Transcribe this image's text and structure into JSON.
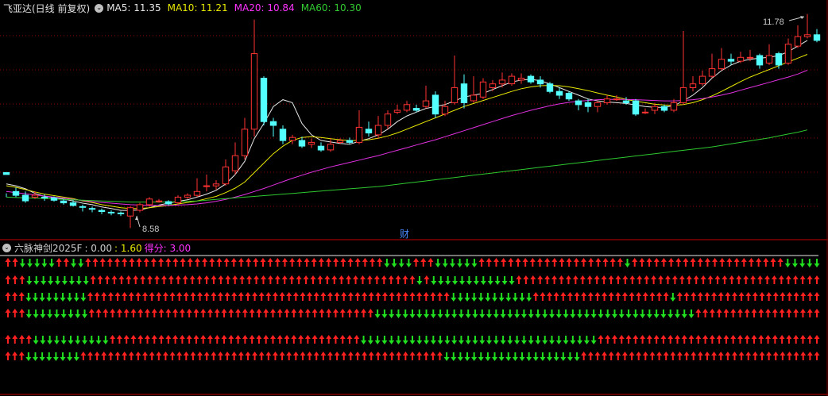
{
  "main_panel": {
    "title": "飞亚达(日线 前复权)",
    "ma_items": [
      {
        "label": "MA5: 11.35",
        "color": "#e8e8e8"
      },
      {
        "label": "MA10: 11.21",
        "color": "#e8e800"
      },
      {
        "label": "MA20: 10.84",
        "color": "#ff33ff"
      },
      {
        "label": "MA60: 10.30",
        "color": "#33cc33"
      }
    ],
    "high_label": "11.78",
    "low_label": "8.58",
    "finance_marker": "财"
  },
  "indicator_panel": {
    "title": "六脉神剑2025F",
    "values": [
      {
        "label": ": 0.00",
        "color": "#d0d0d0"
      },
      {
        "label": ": 1.60",
        "color": "#e8e800"
      },
      {
        "label": "得分: 3.00",
        "color": "#ff33ff"
      }
    ]
  },
  "colors": {
    "up": "#ff3333",
    "down": "#54ffff",
    "ma5": "#e8e8e8",
    "ma10": "#e8e800",
    "ma20": "#e030e0",
    "ma60": "#2ec82e",
    "arrow_up": "#ff2020",
    "arrow_down": "#20e020",
    "grid": "#8b0000",
    "separator": "#c00000"
  },
  "icons": {
    "settings": "circle-chevron-icon",
    "up_arrow": "red-up-arrow-icon",
    "down_arrow": "green-down-arrow-icon"
  },
  "chart_data": {
    "type": "candlestick",
    "y_unit": "price",
    "candles": [
      [
        10.05,
        10.0,
        9.4,
        9.5
      ],
      [
        9.55,
        9.45,
        9.65,
        9.4
      ],
      [
        9.45,
        9.3,
        9.55,
        9.25
      ],
      [
        9.4,
        9.45,
        9.55,
        9.35
      ],
      [
        9.4,
        9.38,
        9.48,
        9.3
      ],
      [
        9.38,
        9.32,
        9.42,
        9.28
      ],
      [
        9.3,
        9.25,
        9.35,
        9.2
      ],
      [
        9.25,
        9.18,
        9.32,
        9.15
      ],
      [
        9.15,
        9.13,
        9.2,
        9.02
      ],
      [
        9.1,
        9.08,
        9.15,
        9.0
      ],
      [
        9.05,
        9.02,
        9.1,
        8.95
      ],
      [
        9.0,
        8.98,
        9.05,
        8.92
      ],
      [
        8.98,
        8.96,
        9.02,
        8.9
      ],
      [
        8.9,
        9.12,
        9.15,
        8.58
      ],
      [
        9.05,
        9.2,
        9.25,
        9.0
      ],
      [
        9.2,
        9.35,
        9.4,
        9.15
      ],
      [
        9.3,
        9.3,
        9.35,
        9.25
      ],
      [
        9.28,
        9.22,
        9.32,
        9.18
      ],
      [
        9.25,
        9.4,
        9.45,
        9.2
      ],
      [
        9.4,
        9.45,
        9.5,
        9.35
      ],
      [
        9.45,
        9.55,
        9.9,
        9.4
      ],
      [
        9.7,
        9.7,
        10.0,
        9.55
      ],
      [
        9.7,
        9.75,
        9.85,
        9.6
      ],
      [
        9.75,
        10.2,
        10.4,
        9.7
      ],
      [
        10.1,
        10.5,
        10.85,
        10.0
      ],
      [
        10.5,
        11.2,
        11.5,
        10.4
      ],
      [
        11.2,
        13.2,
        14.1,
        11.0
      ],
      [
        12.55,
        11.4,
        12.6,
        11.3
      ],
      [
        11.4,
        11.3,
        11.5,
        11.0
      ],
      [
        11.2,
        10.9,
        11.3,
        10.8
      ],
      [
        10.9,
        10.98,
        11.05,
        10.8
      ],
      [
        10.9,
        10.75,
        11.0,
        10.7
      ],
      [
        10.8,
        10.85,
        10.95,
        10.7
      ],
      [
        10.75,
        10.65,
        10.85,
        10.6
      ],
      [
        10.65,
        10.8,
        10.95,
        10.6
      ],
      [
        10.85,
        10.9,
        10.95,
        10.8
      ],
      [
        10.9,
        10.85,
        10.98,
        10.8
      ],
      [
        10.85,
        11.25,
        11.7,
        10.8
      ],
      [
        11.2,
        11.1,
        11.4,
        11.0
      ],
      [
        11.05,
        11.3,
        11.55,
        10.95
      ],
      [
        11.3,
        11.6,
        11.7,
        11.2
      ],
      [
        11.65,
        11.7,
        11.85,
        11.6
      ],
      [
        11.7,
        11.85,
        11.95,
        11.65
      ],
      [
        11.75,
        11.7,
        11.85,
        11.65
      ],
      [
        11.8,
        11.95,
        12.35,
        11.75
      ],
      [
        12.1,
        11.6,
        12.2,
        11.5
      ],
      [
        11.6,
        11.8,
        11.95,
        11.55
      ],
      [
        11.9,
        12.3,
        13.15,
        11.85
      ],
      [
        12.4,
        11.9,
        12.65,
        11.75
      ],
      [
        11.95,
        12.1,
        12.6,
        11.9
      ],
      [
        12.05,
        12.45,
        12.55,
        12.0
      ],
      [
        12.3,
        12.4,
        12.5,
        12.2
      ],
      [
        12.4,
        12.5,
        12.7,
        12.3
      ],
      [
        12.4,
        12.6,
        12.68,
        12.35
      ],
      [
        12.5,
        12.55,
        12.68,
        12.4
      ],
      [
        12.6,
        12.45,
        12.65,
        12.4
      ],
      [
        12.5,
        12.4,
        12.6,
        12.3
      ],
      [
        12.4,
        12.2,
        12.45,
        12.15
      ],
      [
        12.2,
        12.1,
        12.3,
        12.0
      ],
      [
        12.15,
        12.0,
        12.2,
        11.95
      ],
      [
        11.95,
        11.85,
        12.0,
        11.7
      ],
      [
        11.9,
        11.8,
        12.0,
        11.65
      ],
      [
        11.8,
        11.9,
        11.95,
        11.65
      ],
      [
        11.9,
        12.0,
        12.1,
        11.85
      ],
      [
        12.0,
        12.0,
        12.1,
        11.95
      ],
      [
        11.95,
        11.9,
        12.05,
        11.85
      ],
      [
        11.95,
        11.6,
        12.0,
        11.55
      ],
      [
        11.65,
        11.65,
        11.75,
        11.6
      ],
      [
        11.7,
        11.8,
        11.9,
        11.6
      ],
      [
        11.8,
        11.7,
        11.85,
        11.65
      ],
      [
        11.7,
        11.9,
        12.0,
        11.65
      ],
      [
        11.9,
        12.3,
        13.8,
        11.85
      ],
      [
        12.3,
        12.4,
        12.6,
        12.2
      ],
      [
        12.4,
        12.6,
        12.75,
        12.35
      ],
      [
        12.6,
        12.8,
        13.2,
        12.55
      ],
      [
        12.8,
        13.05,
        13.35,
        12.75
      ],
      [
        13.05,
        13.0,
        13.2,
        12.9
      ],
      [
        13.0,
        13.1,
        13.25,
        12.95
      ],
      [
        13.1,
        13.1,
        13.3,
        13.0
      ],
      [
        13.15,
        12.9,
        13.2,
        12.8
      ],
      [
        12.95,
        13.15,
        13.45,
        12.9
      ],
      [
        13.2,
        12.9,
        13.25,
        12.8
      ],
      [
        12.95,
        13.45,
        13.6,
        12.9
      ],
      [
        13.4,
        13.65,
        13.95,
        13.35
      ],
      [
        13.65,
        13.7,
        14.25,
        13.6
      ],
      [
        13.7,
        13.55,
        13.85,
        13.5
      ]
    ],
    "ma_series": [
      {
        "name": "MA5",
        "values": [
          9.75,
          9.7,
          9.62,
          9.5,
          9.42,
          9.39,
          9.35,
          9.3,
          9.24,
          9.2,
          9.14,
          9.1,
          9.05,
          9.05,
          9.06,
          9.12,
          9.19,
          9.24,
          9.29,
          9.33,
          9.4,
          9.48,
          9.58,
          9.75,
          10.0,
          10.35,
          10.95,
          11.35,
          11.8,
          11.98,
          11.9,
          11.35,
          11.05,
          10.9,
          10.86,
          10.82,
          10.8,
          10.88,
          10.95,
          11.05,
          11.2,
          11.4,
          11.55,
          11.65,
          11.75,
          11.8,
          11.85,
          11.95,
          12.05,
          12.1,
          12.15,
          12.25,
          12.35,
          12.45,
          12.5,
          12.52,
          12.48,
          12.4,
          12.3,
          12.2,
          12.1,
          12.0,
          11.95,
          11.92,
          11.9,
          11.88,
          11.84,
          11.8,
          11.78,
          11.78,
          11.82,
          11.95,
          12.1,
          12.3,
          12.55,
          12.75,
          12.9,
          13.0,
          13.05,
          13.08,
          13.1,
          13.15,
          13.25,
          13.4,
          13.55
        ]
      },
      {
        "name": "MA10",
        "values": [
          9.7,
          9.66,
          9.6,
          9.54,
          9.48,
          9.44,
          9.4,
          9.36,
          9.3,
          9.26,
          9.2,
          9.16,
          9.12,
          9.1,
          9.1,
          9.12,
          9.15,
          9.18,
          9.22,
          9.26,
          9.3,
          9.36,
          9.42,
          9.52,
          9.64,
          9.8,
          10.05,
          10.3,
          10.55,
          10.75,
          10.9,
          10.98,
          11.0,
          10.98,
          10.95,
          10.92,
          10.9,
          10.9,
          10.92,
          10.96,
          11.02,
          11.1,
          11.2,
          11.3,
          11.4,
          11.5,
          11.6,
          11.7,
          11.8,
          11.88,
          11.96,
          12.04,
          12.12,
          12.2,
          12.27,
          12.32,
          12.35,
          12.36,
          12.35,
          12.32,
          12.27,
          12.22,
          12.16,
          12.1,
          12.05,
          11.99,
          11.94,
          11.9,
          11.86,
          11.84,
          11.83,
          11.85,
          11.9,
          11.98,
          12.08,
          12.2,
          12.33,
          12.46,
          12.58,
          12.68,
          12.78,
          12.88,
          12.98,
          13.08,
          13.18
        ]
      },
      {
        "name": "MA20",
        "values": [
          9.55,
          9.52,
          9.49,
          9.46,
          9.43,
          9.4,
          9.37,
          9.34,
          9.31,
          9.28,
          9.26,
          9.24,
          9.22,
          9.2,
          9.19,
          9.18,
          9.18,
          9.18,
          9.19,
          9.2,
          9.22,
          9.25,
          9.29,
          9.34,
          9.4,
          9.47,
          9.55,
          9.63,
          9.72,
          9.81,
          9.9,
          9.98,
          10.06,
          10.13,
          10.2,
          10.26,
          10.32,
          10.38,
          10.44,
          10.5,
          10.57,
          10.64,
          10.71,
          10.78,
          10.85,
          10.92,
          11.0,
          11.08,
          11.16,
          11.24,
          11.32,
          11.4,
          11.48,
          11.56,
          11.63,
          11.7,
          11.76,
          11.82,
          11.87,
          11.91,
          11.94,
          11.96,
          11.98,
          11.99,
          11.99,
          11.99,
          11.98,
          11.97,
          11.96,
          11.95,
          11.95,
          11.96,
          11.98,
          12.01,
          12.05,
          12.1,
          12.16,
          12.23,
          12.3,
          12.37,
          12.44,
          12.51,
          12.58,
          12.66,
          12.76
        ]
      },
      {
        "name": "MA60",
        "values": [
          9.4,
          9.39,
          9.38,
          9.37,
          9.36,
          9.35,
          9.34,
          9.33,
          9.32,
          9.31,
          9.3,
          9.29,
          9.28,
          9.27,
          9.27,
          9.27,
          9.27,
          9.27,
          9.28,
          9.29,
          9.3,
          9.32,
          9.34,
          9.36,
          9.38,
          9.4,
          9.42,
          9.44,
          9.46,
          9.48,
          9.5,
          9.52,
          9.54,
          9.56,
          9.58,
          9.6,
          9.62,
          9.64,
          9.66,
          9.68,
          9.71,
          9.74,
          9.77,
          9.8,
          9.83,
          9.86,
          9.89,
          9.92,
          9.95,
          9.98,
          10.01,
          10.04,
          10.07,
          10.1,
          10.13,
          10.16,
          10.19,
          10.22,
          10.25,
          10.28,
          10.31,
          10.34,
          10.37,
          10.4,
          10.43,
          10.46,
          10.49,
          10.52,
          10.55,
          10.58,
          10.61,
          10.64,
          10.67,
          10.7,
          10.73,
          10.77,
          10.81,
          10.85,
          10.89,
          10.93,
          10.97,
          11.02,
          11.07,
          11.12,
          11.18
        ]
      }
    ],
    "signals": [
      "UUDDDDDUUDDUUUUUUUUUUUUUUUUUUUUUUUUUUUUUUUUUUUUUUUUUDDDDUUUDDDDDDUUUUUUUUUUUUUUUUUUUUDUUUUUUUUUUUUUUUUUUUUUDDDDD",
      "UUUDDDDDDDDDUUUUUUUUUUUUUUUUUUUUUUUUUUUUUUUUUUUUUUUUUUUUUUDUDDDDDDDDDDDDUUUUUUUUUUUUUUUUUUUUUUUUUUUUUUUUUUUUUUUUUUU",
      "UUUDDDDDDDDDUUUUUUUUUUUUUUUUUUUUUUUUUUUUUUUUUUUUUUUUUUUUUUUUUUUUUDDDDDDDDDDDDUUUUUUUUUUUUUUUUUUUUDUUUUUUUUUUUUUUUUUUUUU",
      "UUUDDDDDDDDDUUUUUUUUUUUUUUUUUUUUUUUUUUUUUUUUUUUUUUUUUDDDDDDDDDDDDDDDDDDDDDDDDDDDDDDDDDDDDDDDDDDDDDDUUUUUUUUUUUUUUUUUU",
      "UUUUDDDDDDDDDDDUUUUUUUUUUUUUUUUUUUUUUUUUUUUUUUUUUUUDDDDDDDDDDDDDDDDDDDDDDDDDDDDDDDDDDUUUUUUUUUUUUUUUUUUUUUUUUUUUUUUUU",
      "UUUDDDDDDDDUUUUUUUUUUUUUUUUUUUUUUUUUUUUUUUUUUUUUUUUUUUUUUUUUUUUUDDDDDDDDDDDDDDDDDDDDUUUUUUUUUUUUUUUUUUUUUUUUUUUUUUUUUUU"
    ]
  }
}
